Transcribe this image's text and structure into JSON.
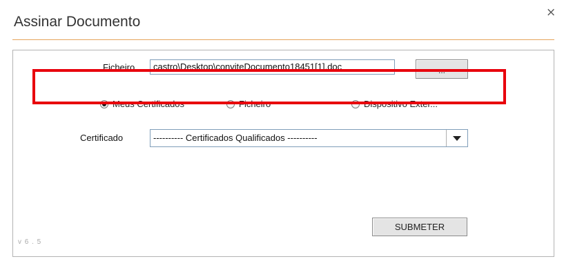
{
  "dialog": {
    "title": "Assinar Documento",
    "close_glyph": "×"
  },
  "form": {
    "file_label": "Ficheiro",
    "file_value": "castro\\Desktop\\conviteDocumento18451[1].doc",
    "browse_label": "...",
    "radios": [
      {
        "label": "Meus Certificados",
        "checked": true
      },
      {
        "label": "Ficheiro",
        "checked": false
      },
      {
        "label": "Dispositivo Exter...",
        "checked": false
      }
    ],
    "certificate_label": "Certificado",
    "certificate_selected": "---------- Certificados Qualificados ----------",
    "submit_label": "SUBMETER",
    "version": "v 6 . 5"
  },
  "colors": {
    "title_rule": "#e6a35a",
    "highlight": "#e8000c"
  },
  "icons": {
    "close": "close-icon",
    "dropdown": "chevron-down-icon"
  }
}
